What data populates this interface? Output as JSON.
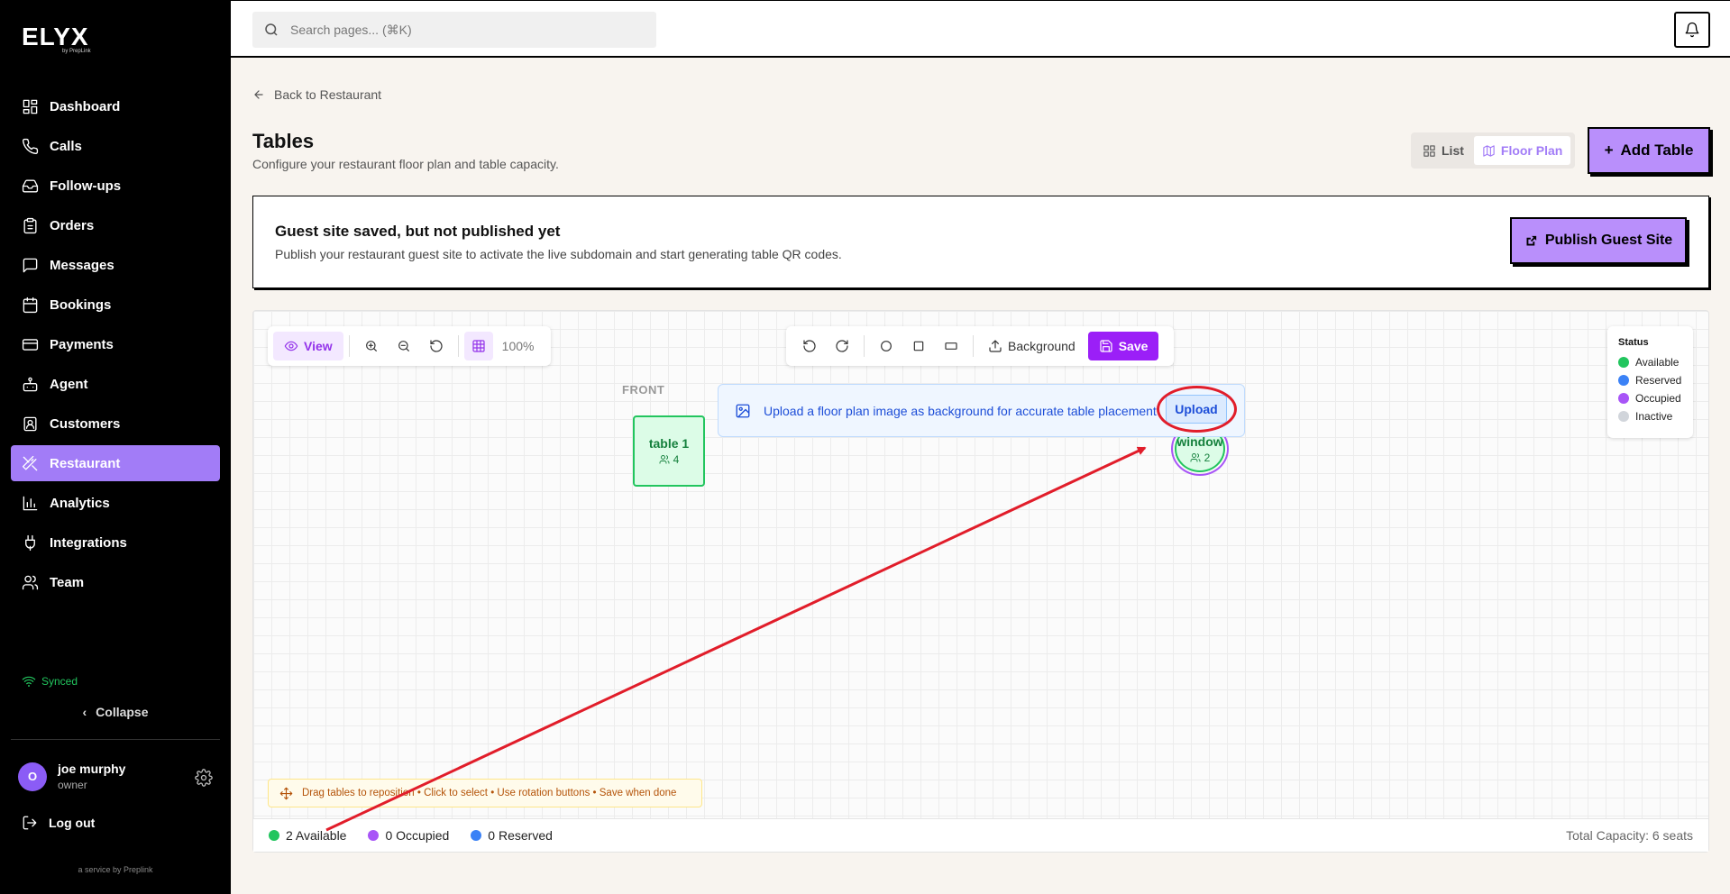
{
  "brand": {
    "name": "ELYX",
    "sub": "by PrepLink"
  },
  "sidebar": {
    "items": [
      {
        "label": "Dashboard",
        "icon": "dashboard-icon"
      },
      {
        "label": "Calls",
        "icon": "phone-icon"
      },
      {
        "label": "Follow-ups",
        "icon": "inbox-icon"
      },
      {
        "label": "Orders",
        "icon": "clipboard-icon"
      },
      {
        "label": "Messages",
        "icon": "message-icon"
      },
      {
        "label": "Bookings",
        "icon": "calendar-icon"
      },
      {
        "label": "Payments",
        "icon": "credit-card-icon"
      },
      {
        "label": "Agent",
        "icon": "bot-icon"
      },
      {
        "label": "Customers",
        "icon": "contact-icon"
      },
      {
        "label": "Restaurant",
        "icon": "utensils-icon",
        "active": true
      },
      {
        "label": "Analytics",
        "icon": "bar-chart-icon"
      },
      {
        "label": "Integrations",
        "icon": "plug-icon"
      },
      {
        "label": "Team",
        "icon": "users-icon"
      }
    ],
    "synced": "Synced",
    "collapse": "Collapse",
    "user": {
      "initial": "O",
      "name": "joe murphy",
      "role": "owner"
    },
    "logout": "Log out",
    "service": "a service by Preplink"
  },
  "topbar": {
    "search_placeholder": "Search pages... (⌘K)"
  },
  "page": {
    "back": "Back to Restaurant",
    "title": "Tables",
    "subtitle": "Configure your restaurant floor plan and table capacity.",
    "view_list": "List",
    "view_floor": "Floor Plan",
    "add_table": "Add Table"
  },
  "notice": {
    "title": "Guest site saved, but not published yet",
    "body": "Publish your restaurant guest site to activate the live subdomain and start generating table QR codes.",
    "button": "Publish Guest Site"
  },
  "toolbar": {
    "view": "View",
    "zoom": "100%",
    "background": "Background",
    "save": "Save"
  },
  "floor": {
    "front_label": "FRONT",
    "upload_text": "Upload a floor plan image as background for accurate table placement",
    "upload_button": "Upload",
    "tables": [
      {
        "name": "table 1",
        "capacity": "4",
        "status": "Available"
      },
      {
        "name": "window",
        "capacity": "2",
        "status": "Available"
      }
    ]
  },
  "status_legend": {
    "title": "Status",
    "items": [
      {
        "label": "Available",
        "color": "#22c55e"
      },
      {
        "label": "Reserved",
        "color": "#3b82f6"
      },
      {
        "label": "Occupied",
        "color": "#a855f7"
      },
      {
        "label": "Inactive",
        "color": "#d1d5db"
      }
    ]
  },
  "hint": "Drag tables to reposition • Click to select • Use rotation buttons • Save when done",
  "summary": {
    "available": "2 Available",
    "occupied": "0 Occupied",
    "reserved": "0 Reserved",
    "total": "Total Capacity: 6 seats"
  },
  "colors": {
    "accent": "#a27cf7",
    "save": "#9b1ff7",
    "annotation": "#e11d2a"
  }
}
